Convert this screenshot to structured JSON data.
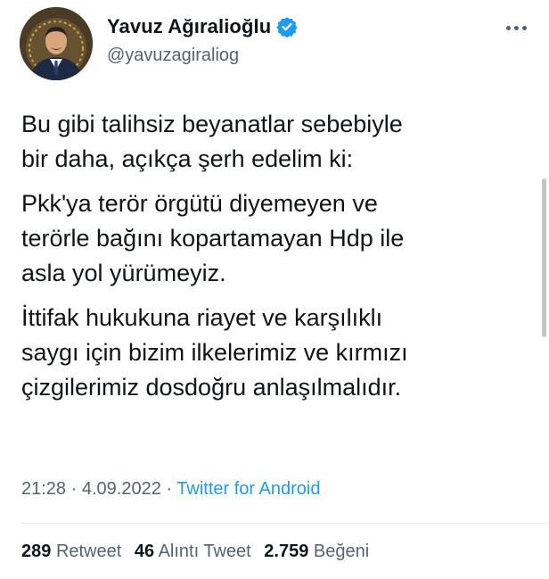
{
  "tweet": {
    "author_name": "Yavuz Ağıralioğlu",
    "author_handle": "@yavuzagiraliog",
    "verified_icon": "verified-badge-icon",
    "more_icon": "more-horizontal-icon",
    "paragraphs": [
      [
        "Bu gibi talihsiz beyanatlar sebebiyle",
        "bir daha, açıkça şerh edelim ki:"
      ],
      [
        "Pkk'ya terör örgütü diyemeyen ve",
        "terörle bağını kopartamayan Hdp ile",
        "asla yol yürümeyiz."
      ],
      [
        "İttifak hukukuna riayet ve karşılıklı",
        "saygı için bizim ilkelerimiz ve kırmızı",
        "çizgilerimiz dosdoğru anlaşılmalıdır."
      ]
    ],
    "time": "21:28",
    "separator": "·",
    "date": "4.09.2022",
    "source": "Twitter for Android",
    "stats": {
      "retweets": "289",
      "retweets_label": "Retweet",
      "quotes": "46",
      "quotes_label": "Alıntı Tweet",
      "likes": "2.759",
      "likes_label": "Beğeni"
    }
  },
  "colors": {
    "text": "#0f1419",
    "secondary": "#536471",
    "accent": "#1d9bf0"
  }
}
